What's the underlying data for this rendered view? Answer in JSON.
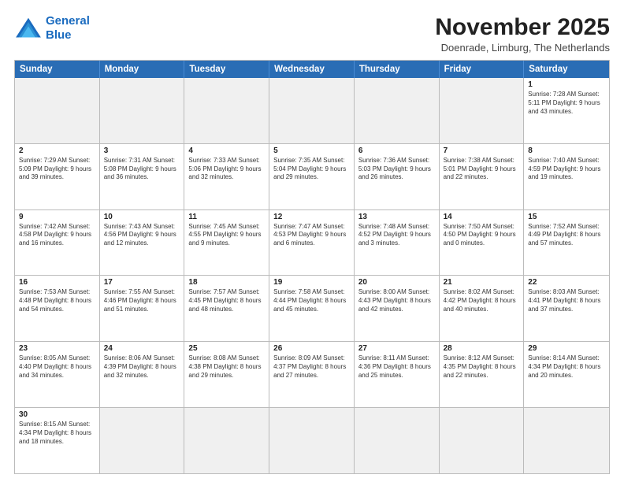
{
  "logo": {
    "line1": "General",
    "line2": "Blue"
  },
  "title": "November 2025",
  "subtitle": "Doenrade, Limburg, The Netherlands",
  "headers": [
    "Sunday",
    "Monday",
    "Tuesday",
    "Wednesday",
    "Thursday",
    "Friday",
    "Saturday"
  ],
  "rows": [
    [
      {
        "day": "",
        "info": "",
        "empty": true
      },
      {
        "day": "",
        "info": "",
        "empty": true
      },
      {
        "day": "",
        "info": "",
        "empty": true
      },
      {
        "day": "",
        "info": "",
        "empty": true
      },
      {
        "day": "",
        "info": "",
        "empty": true
      },
      {
        "day": "",
        "info": "",
        "empty": true
      },
      {
        "day": "1",
        "info": "Sunrise: 7:28 AM\nSunset: 5:11 PM\nDaylight: 9 hours\nand 43 minutes."
      }
    ],
    [
      {
        "day": "2",
        "info": "Sunrise: 7:29 AM\nSunset: 5:09 PM\nDaylight: 9 hours\nand 39 minutes."
      },
      {
        "day": "3",
        "info": "Sunrise: 7:31 AM\nSunset: 5:08 PM\nDaylight: 9 hours\nand 36 minutes."
      },
      {
        "day": "4",
        "info": "Sunrise: 7:33 AM\nSunset: 5:06 PM\nDaylight: 9 hours\nand 32 minutes."
      },
      {
        "day": "5",
        "info": "Sunrise: 7:35 AM\nSunset: 5:04 PM\nDaylight: 9 hours\nand 29 minutes."
      },
      {
        "day": "6",
        "info": "Sunrise: 7:36 AM\nSunset: 5:03 PM\nDaylight: 9 hours\nand 26 minutes."
      },
      {
        "day": "7",
        "info": "Sunrise: 7:38 AM\nSunset: 5:01 PM\nDaylight: 9 hours\nand 22 minutes."
      },
      {
        "day": "8",
        "info": "Sunrise: 7:40 AM\nSunset: 4:59 PM\nDaylight: 9 hours\nand 19 minutes."
      }
    ],
    [
      {
        "day": "9",
        "info": "Sunrise: 7:42 AM\nSunset: 4:58 PM\nDaylight: 9 hours\nand 16 minutes."
      },
      {
        "day": "10",
        "info": "Sunrise: 7:43 AM\nSunset: 4:56 PM\nDaylight: 9 hours\nand 12 minutes."
      },
      {
        "day": "11",
        "info": "Sunrise: 7:45 AM\nSunset: 4:55 PM\nDaylight: 9 hours\nand 9 minutes."
      },
      {
        "day": "12",
        "info": "Sunrise: 7:47 AM\nSunset: 4:53 PM\nDaylight: 9 hours\nand 6 minutes."
      },
      {
        "day": "13",
        "info": "Sunrise: 7:48 AM\nSunset: 4:52 PM\nDaylight: 9 hours\nand 3 minutes."
      },
      {
        "day": "14",
        "info": "Sunrise: 7:50 AM\nSunset: 4:50 PM\nDaylight: 9 hours\nand 0 minutes."
      },
      {
        "day": "15",
        "info": "Sunrise: 7:52 AM\nSunset: 4:49 PM\nDaylight: 8 hours\nand 57 minutes."
      }
    ],
    [
      {
        "day": "16",
        "info": "Sunrise: 7:53 AM\nSunset: 4:48 PM\nDaylight: 8 hours\nand 54 minutes."
      },
      {
        "day": "17",
        "info": "Sunrise: 7:55 AM\nSunset: 4:46 PM\nDaylight: 8 hours\nand 51 minutes."
      },
      {
        "day": "18",
        "info": "Sunrise: 7:57 AM\nSunset: 4:45 PM\nDaylight: 8 hours\nand 48 minutes."
      },
      {
        "day": "19",
        "info": "Sunrise: 7:58 AM\nSunset: 4:44 PM\nDaylight: 8 hours\nand 45 minutes."
      },
      {
        "day": "20",
        "info": "Sunrise: 8:00 AM\nSunset: 4:43 PM\nDaylight: 8 hours\nand 42 minutes."
      },
      {
        "day": "21",
        "info": "Sunrise: 8:02 AM\nSunset: 4:42 PM\nDaylight: 8 hours\nand 40 minutes."
      },
      {
        "day": "22",
        "info": "Sunrise: 8:03 AM\nSunset: 4:41 PM\nDaylight: 8 hours\nand 37 minutes."
      }
    ],
    [
      {
        "day": "23",
        "info": "Sunrise: 8:05 AM\nSunset: 4:40 PM\nDaylight: 8 hours\nand 34 minutes."
      },
      {
        "day": "24",
        "info": "Sunrise: 8:06 AM\nSunset: 4:39 PM\nDaylight: 8 hours\nand 32 minutes."
      },
      {
        "day": "25",
        "info": "Sunrise: 8:08 AM\nSunset: 4:38 PM\nDaylight: 8 hours\nand 29 minutes."
      },
      {
        "day": "26",
        "info": "Sunrise: 8:09 AM\nSunset: 4:37 PM\nDaylight: 8 hours\nand 27 minutes."
      },
      {
        "day": "27",
        "info": "Sunrise: 8:11 AM\nSunset: 4:36 PM\nDaylight: 8 hours\nand 25 minutes."
      },
      {
        "day": "28",
        "info": "Sunrise: 8:12 AM\nSunset: 4:35 PM\nDaylight: 8 hours\nand 22 minutes."
      },
      {
        "day": "29",
        "info": "Sunrise: 8:14 AM\nSunset: 4:34 PM\nDaylight: 8 hours\nand 20 minutes."
      }
    ],
    [
      {
        "day": "30",
        "info": "Sunrise: 8:15 AM\nSunset: 4:34 PM\nDaylight: 8 hours\nand 18 minutes."
      },
      {
        "day": "",
        "info": "",
        "empty": true
      },
      {
        "day": "",
        "info": "",
        "empty": true
      },
      {
        "day": "",
        "info": "",
        "empty": true
      },
      {
        "day": "",
        "info": "",
        "empty": true
      },
      {
        "day": "",
        "info": "",
        "empty": true
      },
      {
        "day": "",
        "info": "",
        "empty": true
      }
    ]
  ]
}
